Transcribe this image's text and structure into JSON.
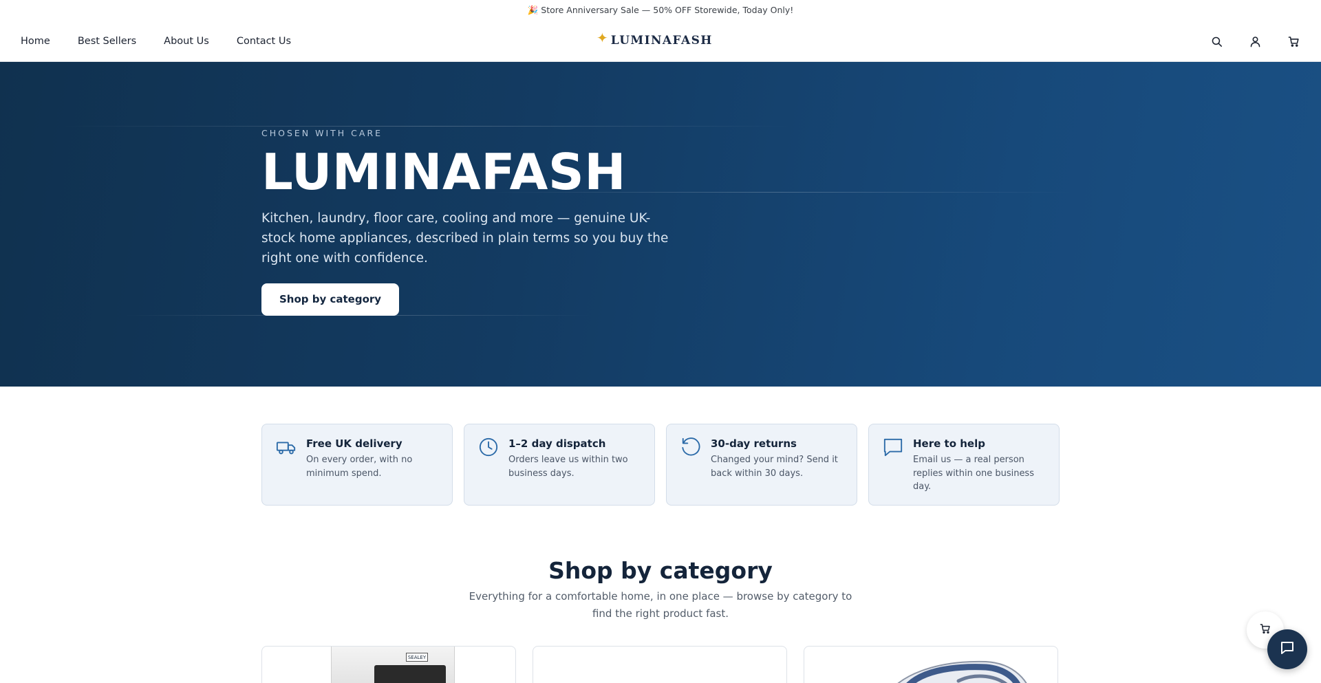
{
  "announcement": {
    "text": "🎉 Store Anniversary Sale — 50% OFF Storewide, Today Only!"
  },
  "nav": {
    "items": [
      {
        "label": "Home"
      },
      {
        "label": "Best Sellers"
      },
      {
        "label": "About Us"
      },
      {
        "label": "Contact Us"
      }
    ]
  },
  "logo": {
    "text": "LUMINAFASH"
  },
  "header_icons": [
    "search-icon",
    "account-icon",
    "cart-icon"
  ],
  "hero": {
    "eyebrow": "CHOSEN WITH CARE",
    "title": "LUMINAFASH",
    "subtitle": "Kitchen, laundry, floor care, cooling and more — genuine UK-stock home appliances, described in plain terms so you buy the right one with confidence.",
    "cta_label": "Shop by category"
  },
  "features": [
    {
      "icon": "truck-icon",
      "title": "Free UK delivery",
      "text": "On every order, with no minimum spend."
    },
    {
      "icon": "clock-icon",
      "title": "1–2 day dispatch",
      "text": "Orders leave us within two business days."
    },
    {
      "icon": "returns-icon",
      "title": "30-day returns",
      "text": "Changed your mind? Send it back within 30 days."
    },
    {
      "icon": "chat-icon",
      "title": "Here to help",
      "text": "Email us — a real person replies within one business day."
    }
  ],
  "category_section": {
    "title": "Shop by category",
    "subtitle": "Everything for a comfortable home, in one place — browse by category to find the right product fast."
  },
  "cards": [
    {
      "image": "air-cooler",
      "brand_badge": "SEALEY"
    },
    {
      "image": "blank"
    },
    {
      "image": "steam-iron"
    }
  ],
  "colors": {
    "hero_bg": "#133b62",
    "accent_star": "#e0a820",
    "feature_bg": "#eef3f9",
    "chat_button": "#1b3350"
  }
}
